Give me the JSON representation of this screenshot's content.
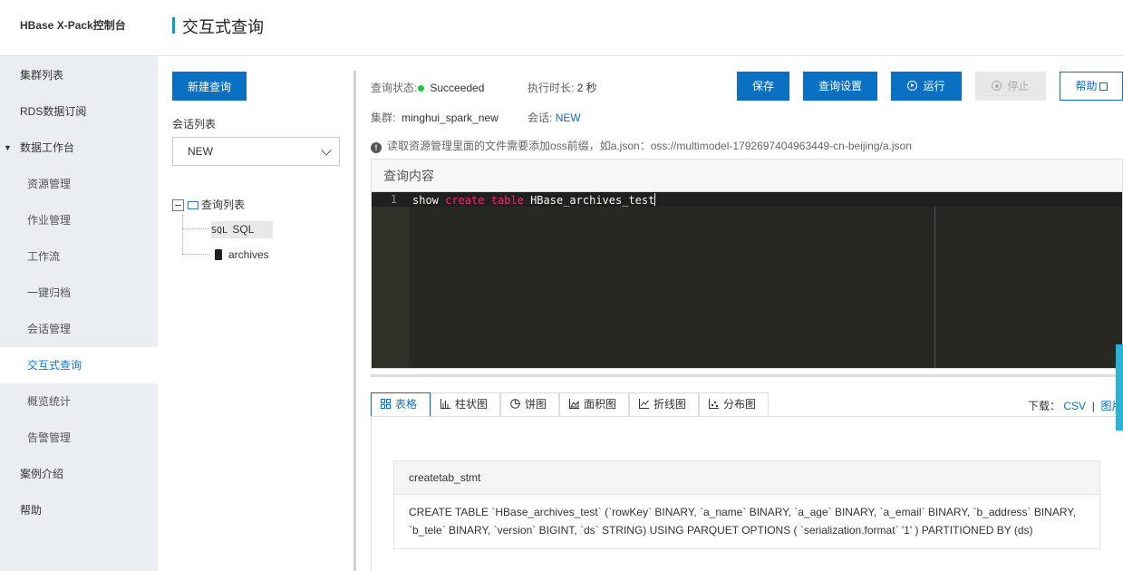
{
  "brand": "HBase X-Pack控制台",
  "page_title": "交互式查询",
  "nav": [
    {
      "label": "集群列表",
      "level": 1
    },
    {
      "label": "RDS数据订阅",
      "level": 1
    },
    {
      "label": "数据工作台",
      "level": 1,
      "expanded": true
    },
    {
      "label": "资源管理",
      "level": 2
    },
    {
      "label": "作业管理",
      "level": 2
    },
    {
      "label": "工作流",
      "level": 2
    },
    {
      "label": "一键归档",
      "level": 2
    },
    {
      "label": "会话管理",
      "level": 2
    },
    {
      "label": "交互式查询",
      "level": 2,
      "active": true
    },
    {
      "label": "概览统计",
      "level": 2
    },
    {
      "label": "告警管理",
      "level": 2
    },
    {
      "label": "案例介绍",
      "level": 1
    },
    {
      "label": "帮助",
      "level": 1
    }
  ],
  "left": {
    "new_query": "新建查询",
    "session_label": "会话列表",
    "session_value": "NEW",
    "tree_root": "查询列表",
    "tree_items": [
      {
        "icon_text": "SQL",
        "label": "SQL",
        "icon": "sql-icon"
      },
      {
        "label": "archives",
        "icon": "database-icon"
      }
    ]
  },
  "status": {
    "status_label": "查询状态:",
    "status_value": "Succeeded",
    "status_color": "#1ec739",
    "duration_label": "执行时长:",
    "duration_value": "2 秒",
    "cluster_label": "集群:",
    "cluster_value": "minghui_spark_new",
    "session_label": "会话:",
    "session_value": "NEW"
  },
  "toolbar": {
    "save": "保存",
    "settings": "查询设置",
    "run": "运行",
    "stop": "停止",
    "help": "帮助"
  },
  "notice": "读取资源管理里面的文件需要添加oss前缀，如a.json：oss://multimodel-1792697404963449-cn-beijing/a.json",
  "editor": {
    "label": "查询内容",
    "line_no": "1",
    "code_plain1": "show ",
    "code_kw1": "create",
    "code_kw2": "table",
    "code_plain2": " HBase_archives_test"
  },
  "result_tabs": [
    "表格",
    "柱状图",
    "饼图",
    "面积图",
    "折线图",
    "分布图"
  ],
  "download": {
    "label": "下载：",
    "csv": "CSV",
    "sep": "|",
    "image": "图片"
  },
  "result": {
    "header": "createtab_stmt",
    "value": "CREATE TABLE `HBase_archives_test` (`rowKey` BINARY, `a_name` BINARY, `a_age` BINARY, `a_email` BINARY, `b_address` BINARY, `b_tele` BINARY, `version` BIGINT, `ds` STRING) USING PARQUET OPTIONS ( `serialization.format` '1' ) PARTITIONED BY (ds)"
  },
  "colors": {
    "primary": "#0a70c4",
    "sidebar_bg": "#eaedf1",
    "editor_bg": "#272822",
    "keyword": "#f92672"
  }
}
